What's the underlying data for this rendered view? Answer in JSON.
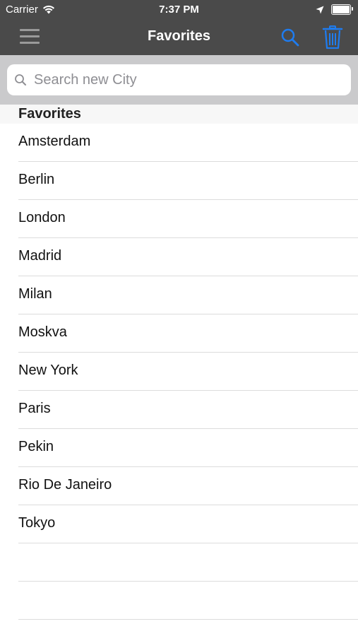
{
  "status_bar": {
    "carrier": "Carrier",
    "time": "7:37 PM"
  },
  "nav": {
    "title": "Favorites",
    "menu_icon": "hamburger-menu-icon",
    "search_icon": "search-icon",
    "trash_icon": "trash-icon",
    "accent_color": "#1e7cf0"
  },
  "search": {
    "placeholder": "Search new City",
    "value": ""
  },
  "section": {
    "title": "Favorites"
  },
  "cities": [
    "Amsterdam",
    "Berlin",
    "London",
    "Madrid",
    "Milan",
    "Moskva",
    "New York",
    "Paris",
    "Pekin",
    "Rio De Janeiro",
    "Tokyo",
    "",
    ""
  ]
}
